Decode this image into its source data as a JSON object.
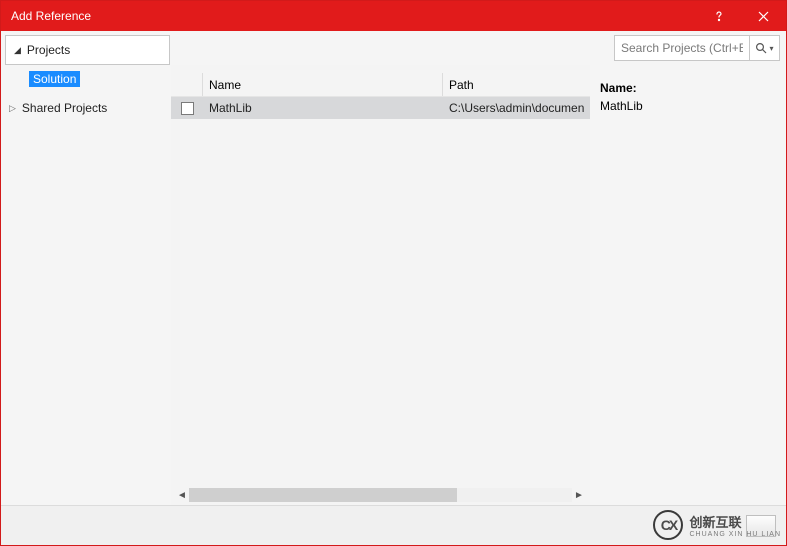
{
  "title": "Add Reference",
  "tree": {
    "top_label": "Projects",
    "selected": "Solution",
    "shared": "Shared Projects"
  },
  "search": {
    "placeholder": "Search Projects (Ctrl+E)"
  },
  "columns": {
    "name": "Name",
    "path": "Path"
  },
  "rows": [
    {
      "name": "MathLib",
      "path": "C:\\Users\\admin\\documen"
    }
  ],
  "detail": {
    "name_label": "Name:",
    "name_value": "MathLib"
  },
  "watermark": {
    "main": "创新互联",
    "sub": "CHUANG XIN HU LIAN"
  }
}
